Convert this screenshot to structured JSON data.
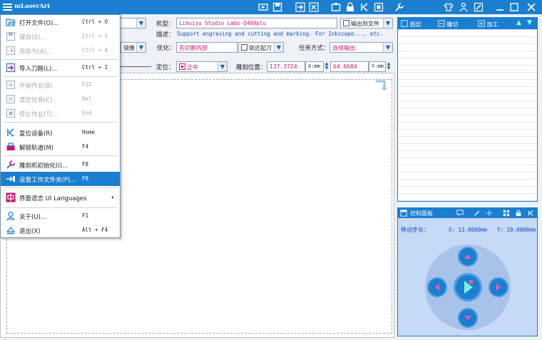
{
  "app": {
    "title": "mLaserArt"
  },
  "menu": {
    "items": [
      {
        "label": "打开文件(O)...",
        "shortcut": "Ctrl + O",
        "icon": "open-file-icon",
        "disabled": false
      },
      {
        "label": "保存(S)...",
        "shortcut": "Ctrl + S",
        "icon": "save-icon",
        "disabled": true
      },
      {
        "label": "另存为(A)...",
        "shortcut": "Ctrl + A",
        "icon": "save-as-icon",
        "disabled": true
      },
      {
        "label": "导入刀路(L)...",
        "shortcut": "Ctrl + I",
        "icon": "import-path-icon",
        "disabled": false
      },
      {
        "label": "开始作业(B)",
        "shortcut": "F12",
        "icon": "start-job-icon",
        "disabled": true
      },
      {
        "label": "清空任务(C)",
        "shortcut": "Del",
        "icon": "clear-tasks-icon",
        "disabled": true
      },
      {
        "label": "停止作业(T)...",
        "shortcut": "End",
        "icon": "stop-job-icon",
        "disabled": true
      },
      {
        "label": "复位设备(R)",
        "shortcut": "Home",
        "icon": "reset-device-icon",
        "disabled": false
      },
      {
        "label": "解锁轨道(M)",
        "shortcut": "F4",
        "icon": "unlock-rail-icon",
        "disabled": false
      },
      {
        "label": "雕刻机初始化(I)...",
        "shortcut": "F8",
        "icon": "engraver-init-icon",
        "disabled": false
      },
      {
        "label": "设置工作文件夹(P)...",
        "shortcut": "F9",
        "icon": "work-folder-icon",
        "disabled": false,
        "selected": true
      },
      {
        "label": "界面语言 UI Languages",
        "shortcut": "▸",
        "icon": "language-icon",
        "disabled": false
      },
      {
        "label": "关于(U)...",
        "shortcut": "F1",
        "icon": "about-icon",
        "disabled": false
      },
      {
        "label": "退出(X)",
        "shortcut": "Alt + F4",
        "icon": "exit-icon",
        "disabled": false
      }
    ]
  },
  "toolbar": {
    "machine_label": "机型：",
    "machine_value": "Lihuiyu Studio Labs-Q460plu",
    "output_to_file": "输出到文件",
    "desc_label": "描述：",
    "desc_value": "Support engraving and cutting and marking. For Inkscape..., etc.",
    "mirror_value": "镜像",
    "optimize_label": "优化：",
    "optimize_value": "先切割内部",
    "nearby_cut": "就近起刀",
    "task_mode_label": "任务方式：",
    "task_mode_value": "连续输出",
    "position_label": "定位：",
    "position_value": "正中",
    "engrave_pos_label": "雕刻位置：",
    "x_value": "137.3724",
    "x_unit": "X:mm",
    "y_value": "64.6684",
    "y_unit": "Y:mm"
  },
  "right_panel": {
    "tabs": [
      "图层",
      "雕切",
      "加工"
    ]
  },
  "control_panel": {
    "title": "控制面板",
    "step_label": "移动步长：",
    "x_step": "X: 13.0000mm",
    "y_step": "Y: 20.0000mm"
  },
  "colors": {
    "accent": "#1a7fd0",
    "value_text": "#d0106a",
    "desc_text": "#1a4fc0"
  }
}
